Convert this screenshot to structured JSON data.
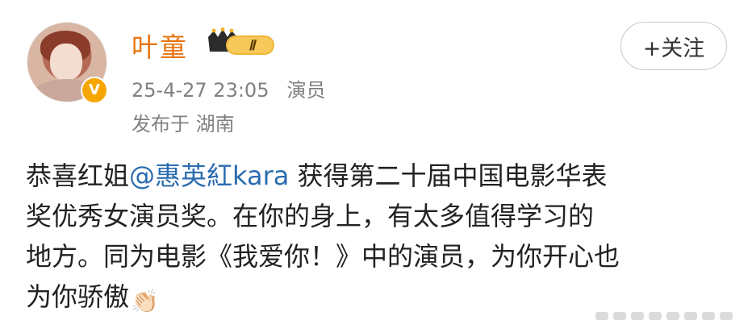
{
  "post": {
    "author": {
      "name": "叶童",
      "badge_text": "Ⅱ",
      "verified": true,
      "avatar_icon": "profile-photo"
    },
    "meta": {
      "time": "25-4-27 23:05",
      "source": "演员",
      "location": "发布于 湖南"
    },
    "follow_label": "+关注",
    "content": {
      "line1_prefix": "恭喜红姐",
      "mention": "@惠英紅kara",
      "line1_suffix": " 获得第二十届中国电影华表",
      "line2": "奖优秀女演员奖。在你的身上，有太多值得学习的",
      "line3": "地方。同为电影《我爱你！》中的演员，为你开心也",
      "line4": "为你骄傲",
      "emoji": "👏🏻"
    },
    "colors": {
      "username": "#e87511",
      "meta": "#808080",
      "mention": "#2b6cb0",
      "verified_badge": "#f7a600"
    }
  }
}
